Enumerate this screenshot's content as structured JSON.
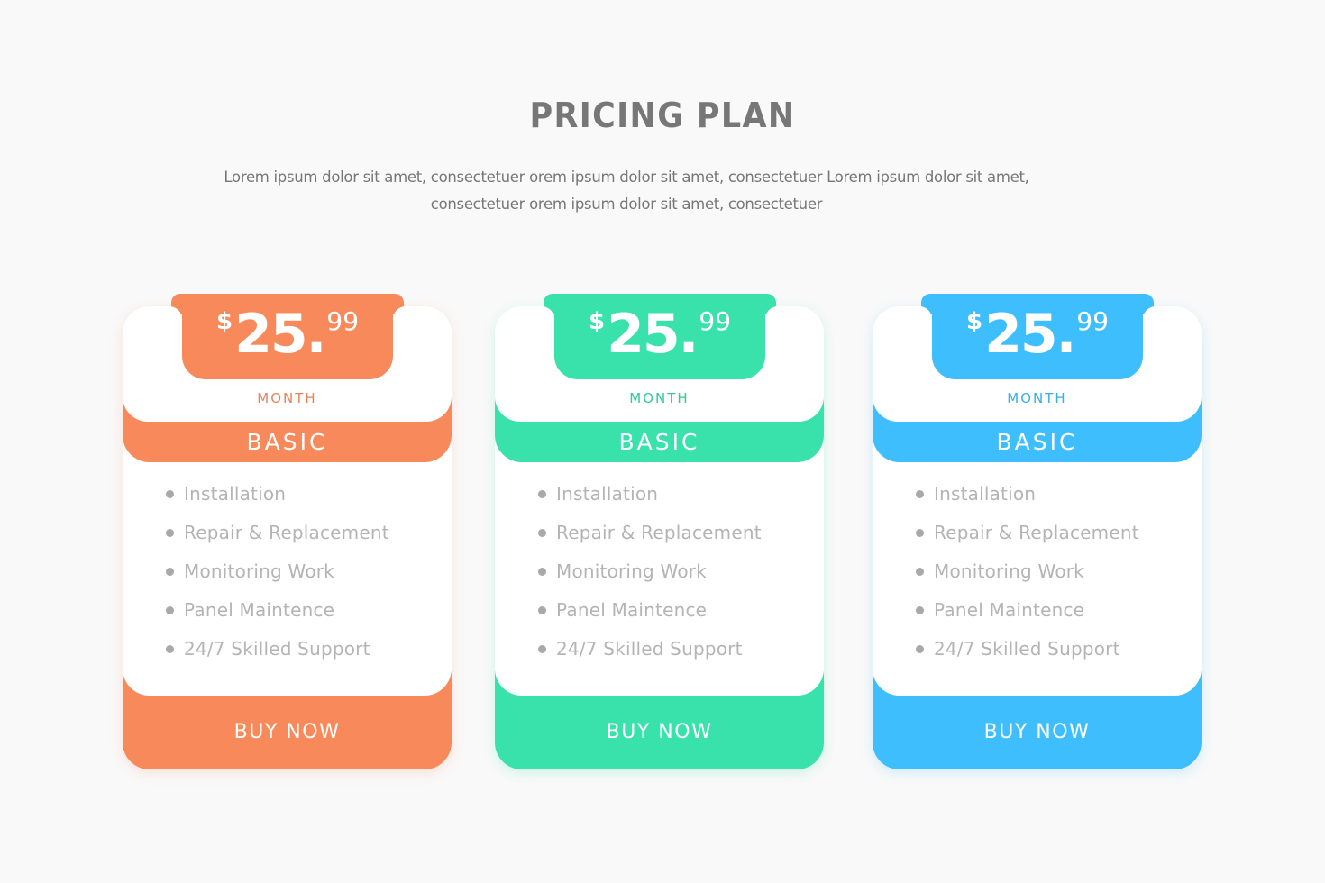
{
  "header": {
    "title": "PRICING PLAN",
    "subtitle": "Lorem ipsum dolor sit amet, consectetuer orem ipsum dolor sit amet, consectetuer Lorem ipsum dolor sit amet, consectetuer orem ipsum dolor sit amet, consectetuer"
  },
  "plans": [
    {
      "currency": "$",
      "amount": "25.",
      "cents": "99",
      "period": "MONTH",
      "name": "BASIC",
      "accent": "#f8895a",
      "period_color": "#e9825a",
      "features": [
        "Installation",
        "Repair & Replacement",
        "Monitoring Work",
        "Panel Maintence",
        "24/7 Skilled Support"
      ],
      "button_label": "BUY NOW"
    },
    {
      "currency": "$",
      "amount": "25.",
      "cents": "99",
      "period": "MONTH",
      "name": "BASIC",
      "accent": "#38e2aa",
      "period_color": "#33c99a",
      "features": [
        "Installation",
        "Repair & Replacement",
        "Monitoring Work",
        "Panel Maintence",
        "24/7 Skilled Support"
      ],
      "button_label": "BUY NOW"
    },
    {
      "currency": "$",
      "amount": "25.",
      "cents": "99",
      "period": "MONTH",
      "name": "BASIC",
      "accent": "#3ebefc",
      "period_color": "#33b0e6",
      "features": [
        "Installation",
        "Repair & Replacement",
        "Monitoring Work",
        "Panel Maintence",
        "24/7 Skilled Support"
      ],
      "button_label": "BUY NOW"
    }
  ]
}
